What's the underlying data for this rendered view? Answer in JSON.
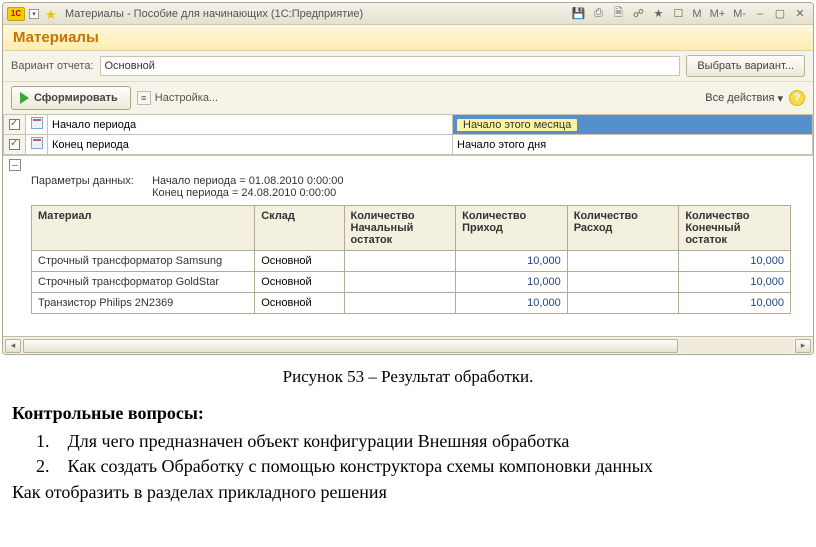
{
  "window": {
    "title": "Материалы - Пособие для начинающих  (1С:Предприятие)",
    "m_labels": {
      "m": "M",
      "mp": "M+",
      "mm": "M-"
    }
  },
  "header": {
    "title": "Материалы"
  },
  "variant": {
    "label": "Вариант отчета:",
    "value": "Основной",
    "choose": "Выбрать вариант..."
  },
  "toolbar": {
    "generate": "Сформировать",
    "settings": "Настройка...",
    "all_actions": "Все действия"
  },
  "period_grid": {
    "rows": [
      {
        "checked": true,
        "name": "Начало периода",
        "value": "Начало этого месяца",
        "selected": true
      },
      {
        "checked": true,
        "name": "Конец периода",
        "value": "Начало этого дня",
        "selected": false
      }
    ]
  },
  "params": {
    "label": "Параметры данных:",
    "lines": [
      "Начало периода = 01.08.2010 0:00:00",
      "Конец периода = 24.08.2010 0:00:00"
    ]
  },
  "columns": {
    "material": "Материал",
    "warehouse": "Склад",
    "qty_initial": "Количество Начальный остаток",
    "qty_in": "Количество Приход",
    "qty_out": "Количество Расход",
    "qty_final": "Количество Конечный остаток"
  },
  "rows": [
    {
      "material": "Строчный трансформатор Samsung",
      "warehouse": "Основной",
      "initial": "",
      "in": "10,000",
      "out": "",
      "final": "10,000"
    },
    {
      "material": "Строчный трансформатор GoldStar",
      "warehouse": "Основной",
      "initial": "",
      "in": "10,000",
      "out": "",
      "final": "10,000"
    },
    {
      "material": "Транзистор Philips 2N2369",
      "warehouse": "Основной",
      "initial": "",
      "in": "10,000",
      "out": "",
      "final": "10,000"
    }
  ],
  "caption": "Рисунок 53 – Результат обработки.",
  "doc": {
    "heading": "Контрольные вопросы:",
    "q1_num": "1.",
    "q1": "Для чего предназначен объект конфигурации Внешняя обработка",
    "q2_num": "2.",
    "q2": "Как создать Обработку с помощью конструктора схемы компоновки данных",
    "q3": "Как отобразить в разделах прикладного решения"
  },
  "chart_data": {
    "type": "table",
    "columns": [
      "Материал",
      "Склад",
      "Количество Начальный остаток",
      "Количество Приход",
      "Количество Расход",
      "Количество Конечный остаток"
    ],
    "data": [
      [
        "Строчный трансформатор Samsung",
        "Основной",
        null,
        10000,
        null,
        10000
      ],
      [
        "Строчный трансформатор GoldStar",
        "Основной",
        null,
        10000,
        null,
        10000
      ],
      [
        "Транзистор Philips 2N2369",
        "Основной",
        null,
        10000,
        null,
        10000
      ]
    ]
  }
}
